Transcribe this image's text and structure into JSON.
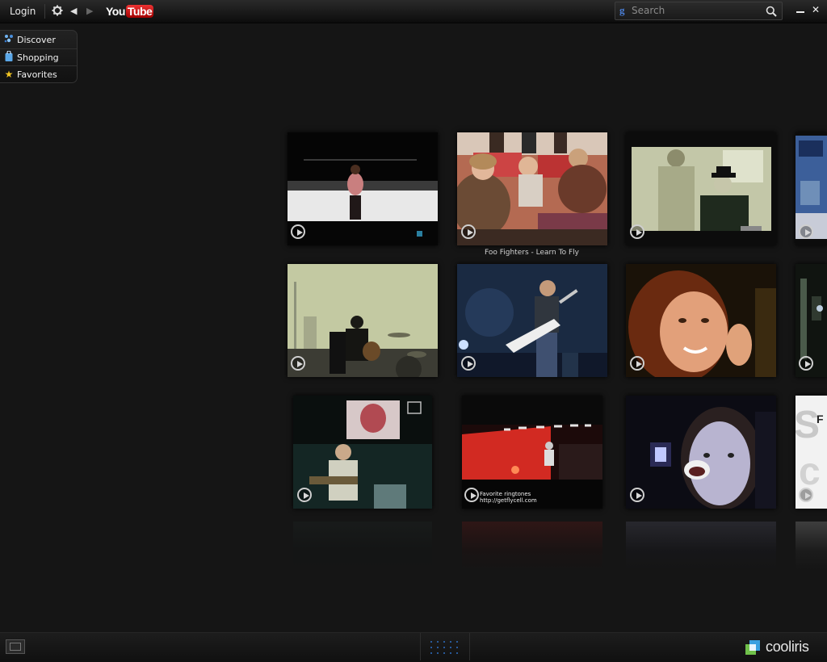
{
  "toolbar": {
    "login_label": "Login",
    "settings_icon": "gear-icon",
    "back_icon": "arrow-left-icon",
    "forward_icon": "arrow-right-icon",
    "source_logo": {
      "you": "You",
      "tube": "Tube"
    },
    "search_placeholder": "Search",
    "search_icon": "magnifier-icon",
    "minimize_icon": "minimize-icon",
    "close_icon": "close-icon"
  },
  "sidemenu": {
    "items": [
      {
        "label": "Discover",
        "icon": "discover-icon"
      },
      {
        "label": "Shopping",
        "icon": "shopping-bag-icon"
      },
      {
        "label": "Favorites",
        "icon": "star-icon"
      }
    ]
  },
  "wall": {
    "caption": "Foo Fighters - Learn To Fly",
    "tiles": [
      {
        "row": 1,
        "col": 1,
        "scene": "performer-on-white-stage"
      },
      {
        "row": 1,
        "col": 2,
        "scene": "passengers-on-airplane",
        "selected": true
      },
      {
        "row": 1,
        "col": 3,
        "scene": "shirtless-man-and-man-in-hat"
      },
      {
        "row": 1,
        "col": 4,
        "scene": "partial-concert-poster"
      },
      {
        "row": 2,
        "col": 1,
        "scene": "band-playing-outdoors"
      },
      {
        "row": 2,
        "col": 2,
        "scene": "guitarist-with-white-guitar"
      },
      {
        "row": 2,
        "col": 3,
        "scene": "smiling-woman"
      },
      {
        "row": 2,
        "col": 4,
        "scene": "partial-dark-stage"
      },
      {
        "row": 3,
        "col": 1,
        "scene": "live-band-under-screen"
      },
      {
        "row": 3,
        "col": 2,
        "scene": "red-stage-with-ringtone-ad"
      },
      {
        "row": 3,
        "col": 3,
        "scene": "man-singing-closeup"
      },
      {
        "row": 3,
        "col": 4,
        "scene": "partial-white-text-card"
      }
    ],
    "ad_text": {
      "line1": "Favorite ringtones",
      "line2": "http://getflycell.com"
    }
  },
  "bottombar": {
    "fullscreen_icon": "fullscreen-icon",
    "grid_icon": "grid-view-icon",
    "brand": "cooliris"
  },
  "colors": {
    "background": "#151515",
    "accent_blue": "#2f6fc4",
    "youtube_red": "#cc0000"
  }
}
